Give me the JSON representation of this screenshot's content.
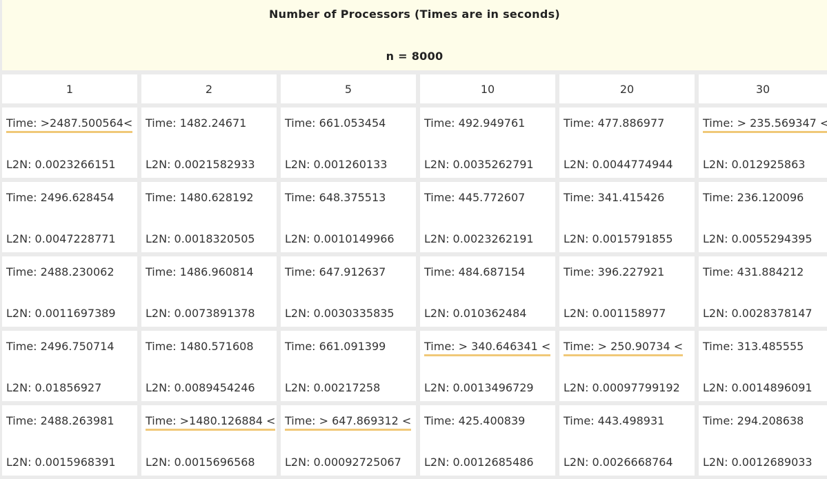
{
  "header": {
    "title": "Number of Processors (Times are in seconds)",
    "n_label": "n = 8000"
  },
  "columns": [
    "1",
    "2",
    "5",
    "10",
    "20",
    "30"
  ],
  "rows": [
    [
      {
        "time": "Time: >2487.500564<",
        "l2n": "L2N: 0.0023266151",
        "highlight": true
      },
      {
        "time": "Time: 1482.24671",
        "l2n": "L2N: 0.0021582933",
        "highlight": false
      },
      {
        "time": "Time: 661.053454",
        "l2n": "L2N: 0.001260133",
        "highlight": false
      },
      {
        "time": "Time: 492.949761",
        "l2n": "L2N: 0.0035262791",
        "highlight": false
      },
      {
        "time": "Time: 477.886977",
        "l2n": "L2N: 0.0044774944",
        "highlight": false
      },
      {
        "time": "Time: > 235.569347 <",
        "l2n": "L2N: 0.012925863",
        "highlight": true
      }
    ],
    [
      {
        "time": "Time: 2496.628454",
        "l2n": "L2N: 0.0047228771",
        "highlight": false
      },
      {
        "time": "Time: 1480.628192",
        "l2n": "L2N: 0.0018320505",
        "highlight": false
      },
      {
        "time": "Time: 648.375513",
        "l2n": "L2N: 0.0010149966",
        "highlight": false
      },
      {
        "time": "Time: 445.772607",
        "l2n": "L2N: 0.0023262191",
        "highlight": false
      },
      {
        "time": "Time: 341.415426",
        "l2n": "L2N: 0.0015791855",
        "highlight": false
      },
      {
        "time": "Time: 236.120096",
        "l2n": "L2N: 0.0055294395",
        "highlight": false
      }
    ],
    [
      {
        "time": "Time: 2488.230062",
        "l2n": "L2N: 0.0011697389",
        "highlight": false
      },
      {
        "time": "Time: 1486.960814",
        "l2n": "L2N: 0.0073891378",
        "highlight": false
      },
      {
        "time": "Time: 647.912637",
        "l2n": "L2N: 0.0030335835",
        "highlight": false
      },
      {
        "time": "Time: 484.687154",
        "l2n": "L2N: 0.010362484",
        "highlight": false
      },
      {
        "time": "Time: 396.227921",
        "l2n": "L2N: 0.001158977",
        "highlight": false
      },
      {
        "time": "Time: 431.884212",
        "l2n": "L2N: 0.0028378147",
        "highlight": false
      }
    ],
    [
      {
        "time": "Time: 2496.750714",
        "l2n": "L2N: 0.01856927",
        "highlight": false
      },
      {
        "time": "Time: 1480.571608",
        "l2n": "L2N: 0.0089454246",
        "highlight": false
      },
      {
        "time": "Time: 661.091399",
        "l2n": "L2N: 0.00217258",
        "highlight": false
      },
      {
        "time": "Time: > 340.646341 <",
        "l2n": "L2N: 0.0013496729",
        "highlight": true
      },
      {
        "time": "Time: > 250.90734 <",
        "l2n": "L2N: 0.00097799192",
        "highlight": true
      },
      {
        "time": "Time: 313.485555",
        "l2n": "L2N: 0.0014896091",
        "highlight": false
      }
    ],
    [
      {
        "time": "Time: 2488.263981",
        "l2n": "L2N: 0.0015968391",
        "highlight": false
      },
      {
        "time": "Time: >1480.126884 <",
        "l2n": "L2N: 0.0015696568",
        "highlight": true
      },
      {
        "time": "Time: > 647.869312 <",
        "l2n": "L2N: 0.00092725067",
        "highlight": true
      },
      {
        "time": "Time: 425.400839",
        "l2n": "L2N: 0.0012685486",
        "highlight": false
      },
      {
        "time": "Time: 443.498931",
        "l2n": "L2N: 0.0026668764",
        "highlight": false
      },
      {
        "time": "Time: 294.208638",
        "l2n": "L2N: 0.0012689033",
        "highlight": false
      }
    ]
  ],
  "colors": {
    "header_bg": "#fefde9",
    "highlight_underline": "#f0c878",
    "cell_bg": "#ffffff",
    "grid_gap": "#ebebeb"
  }
}
